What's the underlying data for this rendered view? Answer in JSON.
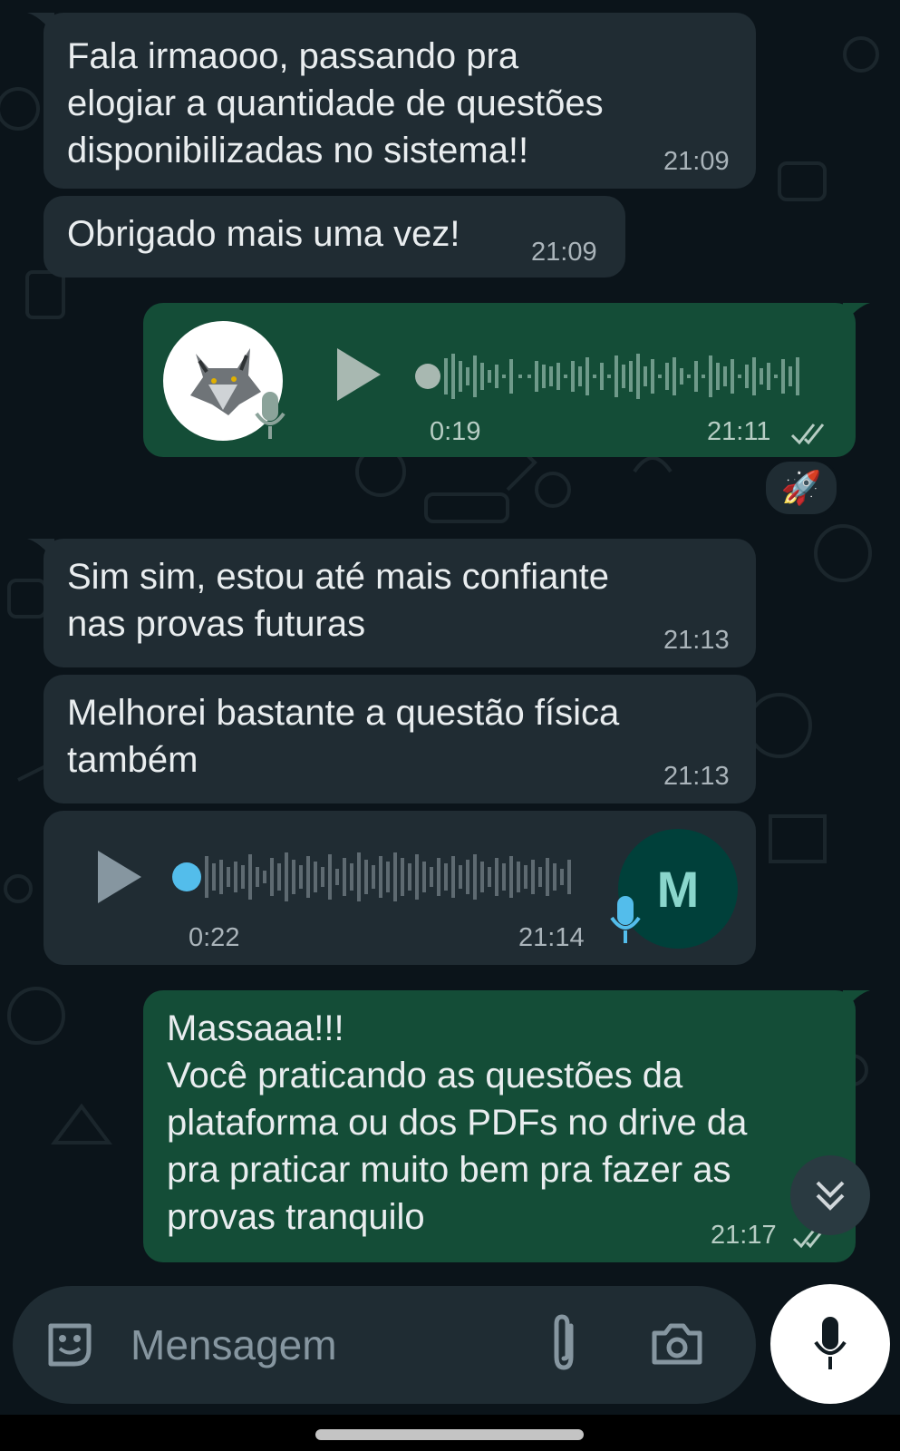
{
  "messages": [
    {
      "text": "Fala irmaooo, passando pra\nelogiar a quantidade de questões\ndisponibilizadas no sistema!!",
      "time": "21:09"
    },
    {
      "text": "Obrigado mais uma vez!",
      "time": "21:09"
    },
    {
      "audio_duration": "0:19",
      "time": "21:11",
      "reaction": "🚀"
    },
    {
      "text": "Sim sim, estou até mais confiante\nnas provas futuras",
      "time": "21:13"
    },
    {
      "text": "Melhorei bastante a questão física\ntambém",
      "time": "21:13"
    },
    {
      "audio_duration": "0:22",
      "time": "21:14",
      "avatar_letter": "M"
    },
    {
      "text": "Massaaa!!!\nVocê praticando as questões da\nplataforma ou dos PDFs no drive da\npra praticar muito bem pra fazer as\nprovas tranquilo",
      "time": "21:17"
    }
  ],
  "composer": {
    "placeholder": "Mensagem"
  },
  "colors": {
    "incoming": "#202c33",
    "outgoing": "#144d37",
    "accent_blue": "#53bdeb",
    "background": "#0b141a"
  }
}
